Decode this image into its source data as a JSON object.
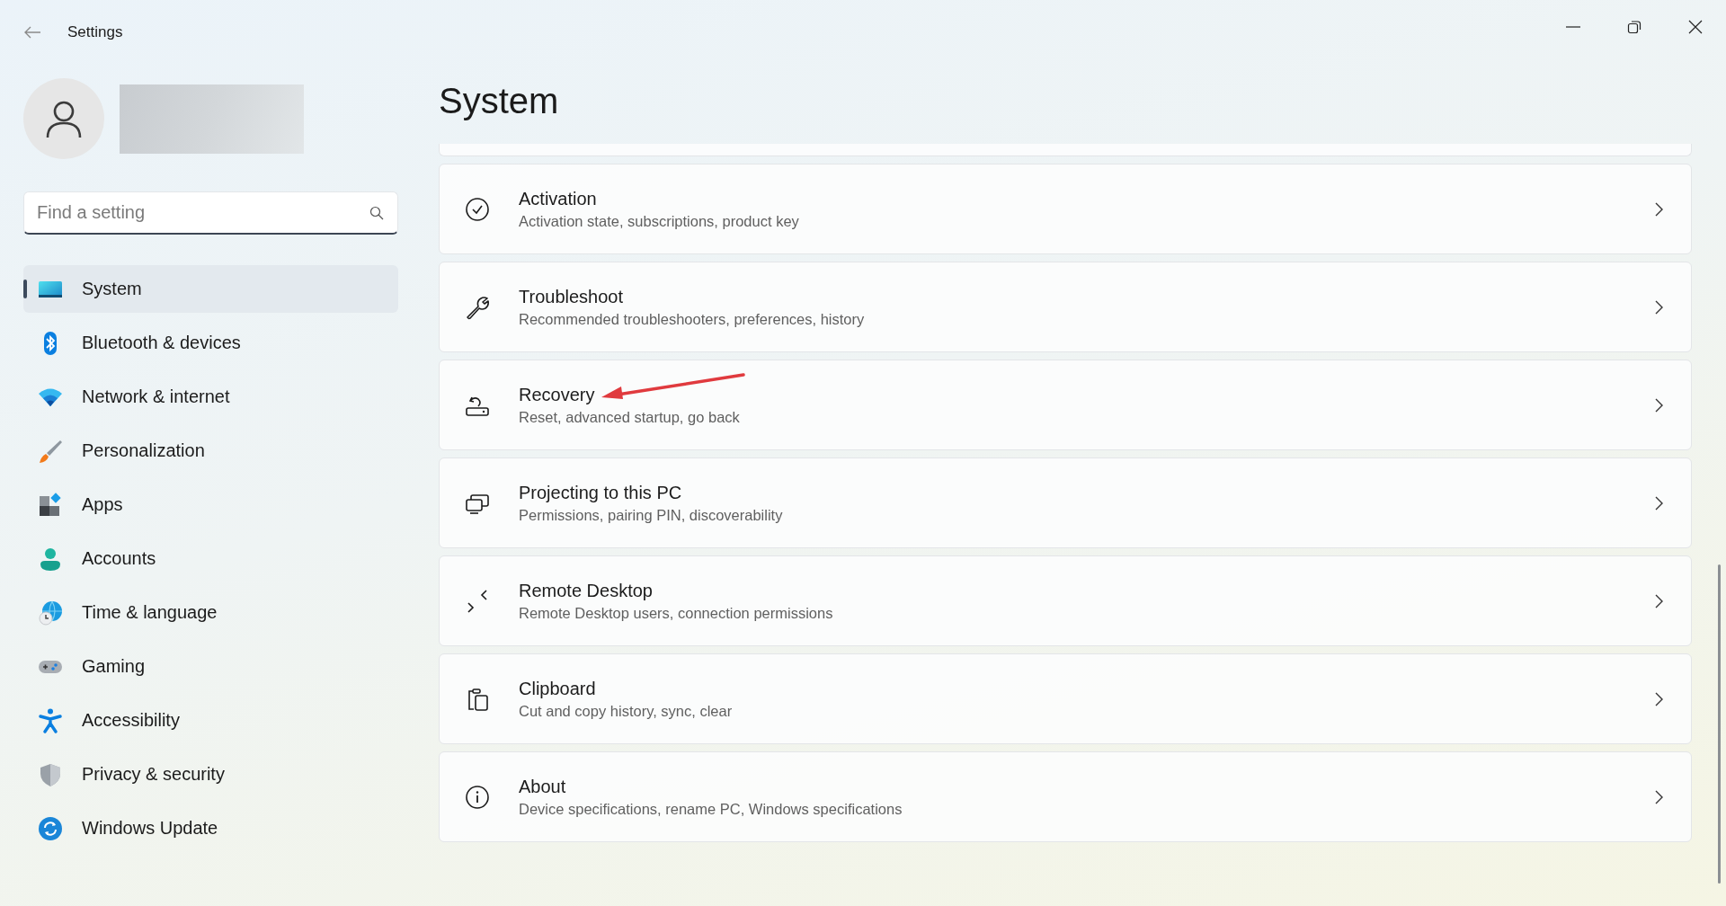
{
  "window": {
    "title": "Settings"
  },
  "search": {
    "placeholder": "Find a setting"
  },
  "sidebar": {
    "items": [
      {
        "label": "System",
        "selected": true
      },
      {
        "label": "Bluetooth & devices",
        "selected": false
      },
      {
        "label": "Network & internet",
        "selected": false
      },
      {
        "label": "Personalization",
        "selected": false
      },
      {
        "label": "Apps",
        "selected": false
      },
      {
        "label": "Accounts",
        "selected": false
      },
      {
        "label": "Time & language",
        "selected": false
      },
      {
        "label": "Gaming",
        "selected": false
      },
      {
        "label": "Accessibility",
        "selected": false
      },
      {
        "label": "Privacy & security",
        "selected": false
      },
      {
        "label": "Windows Update",
        "selected": false
      }
    ]
  },
  "page": {
    "title": "System"
  },
  "cards": [
    {
      "title": "Activation",
      "subtitle": "Activation state, subscriptions, product key",
      "annotated": false
    },
    {
      "title": "Troubleshoot",
      "subtitle": "Recommended troubleshooters, preferences, history",
      "annotated": false
    },
    {
      "title": "Recovery",
      "subtitle": "Reset, advanced startup, go back",
      "annotated": true
    },
    {
      "title": "Projecting to this PC",
      "subtitle": "Permissions, pairing PIN, discoverability",
      "annotated": false
    },
    {
      "title": "Remote Desktop",
      "subtitle": "Remote Desktop users, connection permissions",
      "annotated": false
    },
    {
      "title": "Clipboard",
      "subtitle": "Cut and copy history, sync, clear",
      "annotated": false
    },
    {
      "title": "About",
      "subtitle": "Device specifications, rename PC, Windows specifications",
      "annotated": false
    }
  ]
}
